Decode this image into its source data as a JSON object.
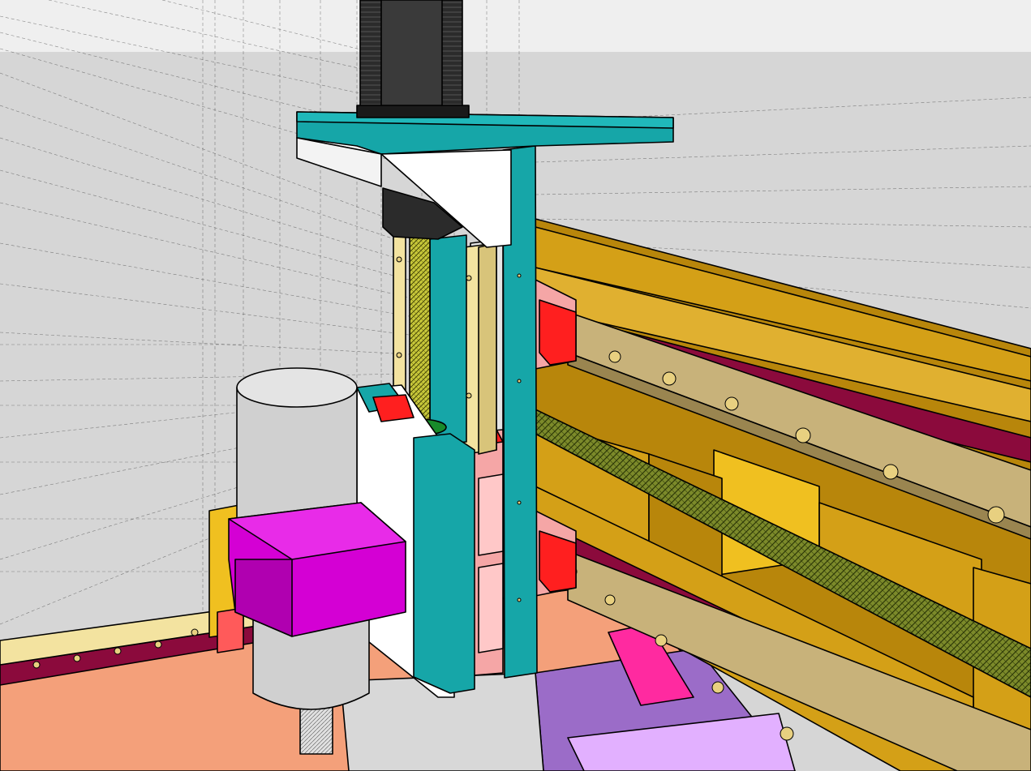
{
  "scene": {
    "colors": {
      "sky": "#efefef",
      "ground": "#d6d6d6",
      "teal": "#16a6a8",
      "white_part": "#ffffff",
      "gantry_gold": "#d4a017",
      "gantry_gold_dark": "#b8860b",
      "rail_tan": "#c8b27a",
      "rail_bed_maroon": "#8b0a3c",
      "carriage_red": "#ff1f1f",
      "carriage_pink": "#f5a6a6",
      "leadscrew_olive": "#7c8a2a",
      "spindle_grey": "#d0d0d0",
      "spindle_clamp_magenta": "#d400d4",
      "bed_salmon": "#f4a07a",
      "bed_purple": "#9b6cc8",
      "motor_black": "#2b2b2b",
      "linear_rail_cream": "#f3e3a0"
    },
    "icons": [
      "stepper-motor-icon",
      "spindle-icon",
      "linear-rail-icon",
      "lead-screw-icon"
    ]
  }
}
